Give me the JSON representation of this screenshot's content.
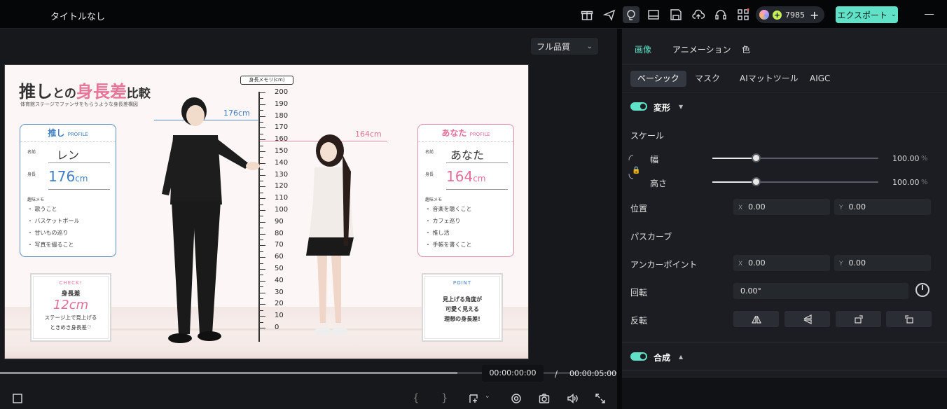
{
  "window": {
    "title": "タイトルなし"
  },
  "toolbar": {
    "icons": [
      "gift-icon",
      "send-icon",
      "mentor-icon",
      "layout-icon",
      "save-icon",
      "cloud-upload-icon",
      "headset-icon",
      "apps-icon"
    ],
    "credits": "7985",
    "export_label": "エクスポート"
  },
  "preview": {
    "quality": "フル品質",
    "timecode": "00:00:00:00",
    "separator": "/",
    "duration": "00:00:05:00",
    "progress_percent": 77
  },
  "poster": {
    "title_a": "推し",
    "title_b": "との",
    "title_c": "身長差",
    "title_d": "比較",
    "subtitle": "体育館ステージでファンサをもらうような身長差構図",
    "ruler_label": "身長メモリ(cm)",
    "ruler_ticks": [
      "200",
      "190",
      "180",
      "170",
      "160",
      "150",
      "140",
      "130",
      "120",
      "110",
      "100",
      "90",
      "80",
      "70",
      "60",
      "50",
      "40",
      "30",
      "20",
      "10",
      "0"
    ],
    "oshi_height_label": "176cm",
    "you_height_label": "164cm",
    "oshi_card": {
      "head": "推し",
      "head_sub": "PROFILE",
      "name_label": "名前",
      "name": "レン",
      "height_label": "身長",
      "height_num": "176",
      "height_unit": "cm",
      "hobby_label": "趣味メモ",
      "hobbies": [
        "・ 歌うこと",
        "・ バスケットボール",
        "・ 甘いもの巡り",
        "・ 写真を撮ること"
      ]
    },
    "you_card": {
      "head": "あなた",
      "head_sub": "PROFILE",
      "name_label": "名前",
      "name": "あなた",
      "height_label": "身長",
      "height_num": "164",
      "height_unit": "cm",
      "hobby_label": "趣味メモ",
      "hobbies": [
        "・ 音楽を聴くこと",
        "・ カフェ巡り",
        "・ 推し活",
        "・ 手帳を書くこと"
      ]
    },
    "check_box": {
      "tag": "CHECK!",
      "title": "身長差",
      "big": "12cm",
      "line1": "ステージ上で見上げる",
      "line2": "ときめき身長差♡"
    },
    "point_box": {
      "tag": "POINT",
      "line1": "見上げる角度が",
      "line2": "可愛く見える",
      "line3": "理想の身長差!"
    }
  },
  "panel": {
    "tabs": [
      "画像",
      "アニメーション",
      "色"
    ],
    "subtabs": [
      "ベーシック",
      "マスク",
      "AIマットツール",
      "AIGC"
    ],
    "transform": {
      "title": "変形",
      "scale_label": "スケール",
      "width_label": "幅",
      "height_label": "高さ",
      "width_value": "100.00",
      "height_value": "100.00",
      "unit": "%",
      "width_fraction": 0.26,
      "height_fraction": 0.26,
      "position_label": "位置",
      "pos_x_axis": "X",
      "pos_x": "0.00",
      "pos_y_axis": "Y",
      "pos_y": "0.00",
      "path_curve_label": "パスカーブ",
      "anchor_label": "アンカーポイント",
      "anchor_x_axis": "X",
      "anchor_x": "0.00",
      "anchor_y_axis": "Y",
      "anchor_y": "0.00",
      "rotate_label": "回転",
      "rotate_value": "0.00°",
      "flip_label": "反転"
    },
    "composite": {
      "title": "合成"
    }
  }
}
